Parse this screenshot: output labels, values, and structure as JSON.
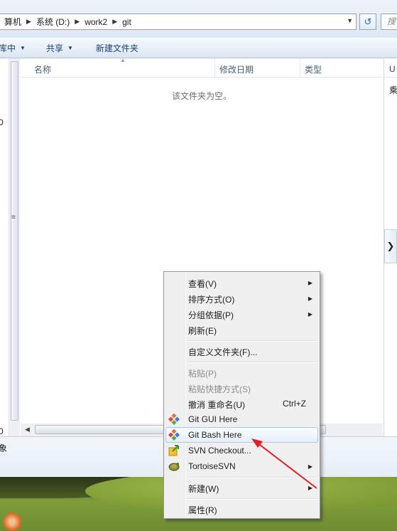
{
  "address": {
    "crumbs": [
      "算机",
      "系统 (D:)",
      "work2",
      "git"
    ],
    "search_placeholder": "搜"
  },
  "toolbar": {
    "library_label": "库中",
    "share_label": "共享",
    "new_folder_label": "新建文件夹"
  },
  "navpane": {
    "fragment_a": "0",
    "fragment_b": "0"
  },
  "filelist": {
    "columns": [
      "名称",
      "修改日期",
      "类型"
    ],
    "empty_message": "该文件夹为空。"
  },
  "rightpane": {
    "header": "U",
    "row": "乘"
  },
  "details": {
    "text": "象"
  },
  "context_menu": {
    "items": [
      {
        "label": "查看(V)",
        "submenu": true
      },
      {
        "label": "排序方式(O)",
        "submenu": true
      },
      {
        "label": "分组依据(P)",
        "submenu": true
      },
      {
        "label": "刷新(E)"
      },
      {
        "label": "自定义文件夹(F)..."
      },
      {
        "label": "粘贴(P)",
        "disabled": true
      },
      {
        "label": "粘贴快捷方式(S)",
        "disabled": true
      },
      {
        "label": "撤消 重命名(U)",
        "shortcut": "Ctrl+Z"
      },
      {
        "label": "Git GUI Here",
        "icon": "git-gui-icon"
      },
      {
        "label": "Git Bash Here",
        "icon": "git-bash-icon",
        "highlighted": true
      },
      {
        "label": "SVN Checkout...",
        "icon": "svn-checkout-icon"
      },
      {
        "label": "TortoiseSVN",
        "icon": "tortoisesvn-icon",
        "submenu": true
      },
      {
        "label": "新建(W)",
        "submenu": true
      },
      {
        "label": "属性(R)"
      }
    ]
  },
  "colors": {
    "annotation_arrow": "#e02020",
    "highlight_border": "#a8c8ec"
  }
}
